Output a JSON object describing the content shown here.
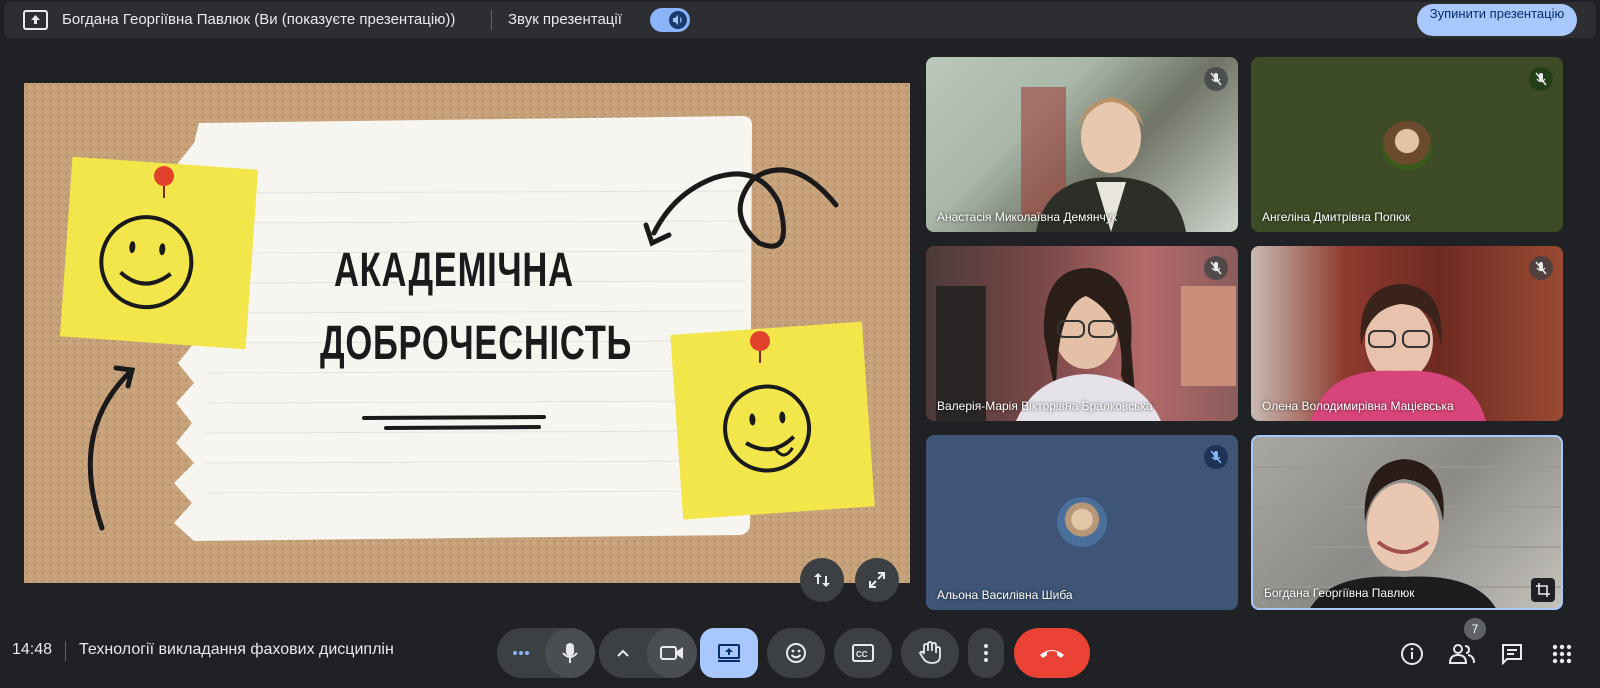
{
  "topbar": {
    "presenter_title": "Богдана Георгіївна Павлюк (Ви (показуєте презентацію))",
    "sound_label": "Звук презентації",
    "stop_button_label": "Зупинити презентацію",
    "present_icon": "present-to-all-icon",
    "sound_toggle_on": true
  },
  "slide": {
    "title_line1": "АКАДЕМІЧНА",
    "title_line2": "ДОБРОЧЕСНІСТЬ"
  },
  "participants": [
    {
      "name": "Анастасія Миколаївна Демянчук",
      "muted": true
    },
    {
      "name": "Ангеліна Дмитрівна Попюк",
      "muted": true
    },
    {
      "name": "Валерія-Марія Вікторівна Бралковська",
      "muted": true
    },
    {
      "name": "Олена Володимирівна Мацієвська",
      "muted": true
    },
    {
      "name": "Альона Василівна Шиба",
      "muted": true
    },
    {
      "name": "Богдана Георгіївна Павлюк",
      "muted": false
    }
  ],
  "footer": {
    "time": "14:48",
    "meeting_title": "Технології викладання фахових дисциплін",
    "participants_count": "7"
  },
  "colors": {
    "background": "#202124",
    "accent": "#8ab4f8",
    "end_call": "#ea4335",
    "present_active": "#a8c7fa"
  }
}
